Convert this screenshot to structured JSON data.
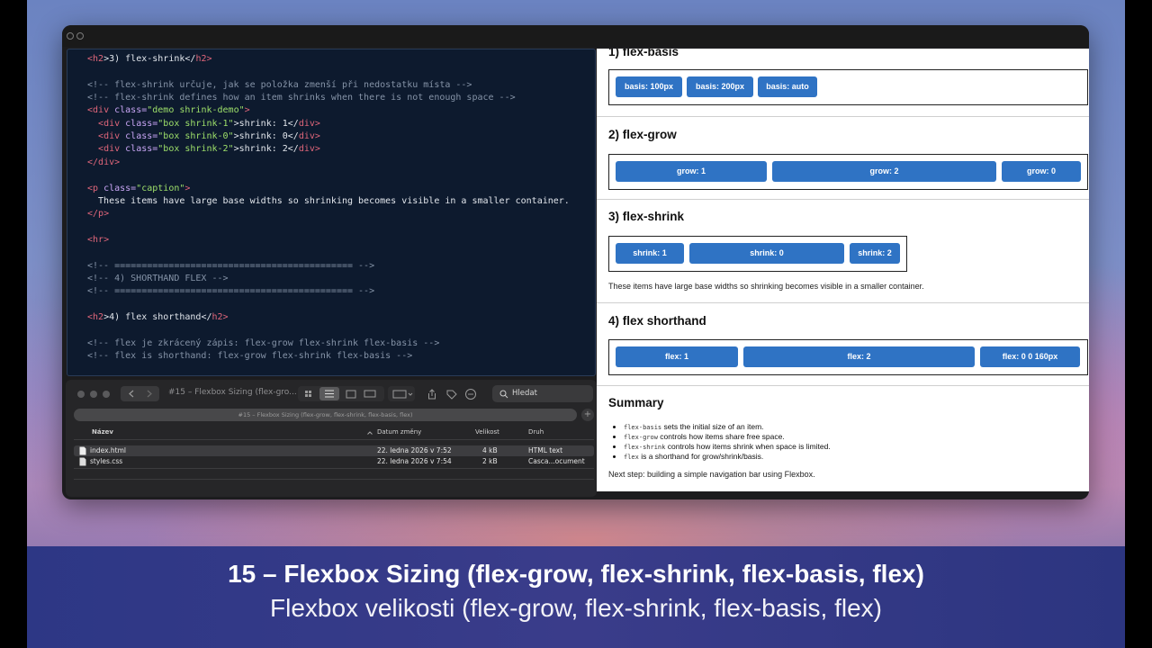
{
  "editor": {
    "lines": [
      [
        [
          "<",
          "tag"
        ],
        [
          "h2",
          "tag"
        ],
        [
          ">3) flex-shrink</",
          "txt"
        ],
        [
          "h2",
          "tag"
        ],
        [
          ">",
          "tag"
        ]
      ],
      [],
      [
        [
          "<!-- flex-shrink určuje, jak se položka zmenší při nedostatku místa -->",
          "cmt"
        ]
      ],
      [
        [
          "<!-- flex-shrink defines how an item shrinks when there is not enough space -->",
          "cmt"
        ]
      ],
      [
        [
          "<",
          "tag"
        ],
        [
          "div ",
          "tag"
        ],
        [
          "class=",
          "attr"
        ],
        [
          "\"demo shrink-demo\"",
          "str"
        ],
        [
          ">",
          "tag"
        ]
      ],
      [
        [
          "  <",
          "tag"
        ],
        [
          "div ",
          "tag"
        ],
        [
          "class=",
          "attr"
        ],
        [
          "\"box shrink-1\"",
          "str"
        ],
        [
          ">shrink: 1</",
          "txt"
        ],
        [
          "div",
          "tag"
        ],
        [
          ">",
          "tag"
        ]
      ],
      [
        [
          "  <",
          "tag"
        ],
        [
          "div ",
          "tag"
        ],
        [
          "class=",
          "attr"
        ],
        [
          "\"box shrink-0\"",
          "str"
        ],
        [
          ">shrink: 0</",
          "txt"
        ],
        [
          "div",
          "tag"
        ],
        [
          ">",
          "tag"
        ]
      ],
      [
        [
          "  <",
          "tag"
        ],
        [
          "div ",
          "tag"
        ],
        [
          "class=",
          "attr"
        ],
        [
          "\"box shrink-2\"",
          "str"
        ],
        [
          ">shrink: 2</",
          "txt"
        ],
        [
          "div",
          "tag"
        ],
        [
          ">",
          "tag"
        ]
      ],
      [
        [
          "</",
          "tag"
        ],
        [
          "div",
          "tag"
        ],
        [
          ">",
          "tag"
        ]
      ],
      [],
      [
        [
          "<",
          "tag"
        ],
        [
          "p ",
          "tag"
        ],
        [
          "class=",
          "attr"
        ],
        [
          "\"caption\"",
          "str"
        ],
        [
          ">",
          "tag"
        ]
      ],
      [
        [
          "  These items have large base widths so shrinking becomes visible in a smaller container.",
          "txt"
        ]
      ],
      [
        [
          "</",
          "tag"
        ],
        [
          "p",
          "tag"
        ],
        [
          ">",
          "tag"
        ]
      ],
      [],
      [
        [
          "<",
          "tag"
        ],
        [
          "hr",
          "tag"
        ],
        [
          ">",
          "tag"
        ]
      ],
      [],
      [
        [
          "<!-- ============================================ -->",
          "cmt"
        ]
      ],
      [
        [
          "<!-- 4) SHORTHAND FLEX -->",
          "cmt"
        ]
      ],
      [
        [
          "<!-- ============================================ -->",
          "cmt"
        ]
      ],
      [],
      [
        [
          "<",
          "tag"
        ],
        [
          "h2",
          "tag"
        ],
        [
          ">4) flex shorthand</",
          "txt"
        ],
        [
          "h2",
          "tag"
        ],
        [
          ">",
          "tag"
        ]
      ],
      [],
      [
        [
          "<!-- flex je zkrácený zápis: flex-grow flex-shrink flex-basis -->",
          "cmt"
        ]
      ],
      [
        [
          "<!-- flex is shorthand: flex-grow flex-shrink flex-basis -->",
          "cmt"
        ]
      ]
    ]
  },
  "finder": {
    "title": "#15 – Flexbox Sizing (flex-gro...",
    "search_placeholder": "Hledat",
    "path": "#15 – Flexbox Sizing (flex-grow, flex-shrink, flex-basis, flex)",
    "columns": {
      "name": "Název",
      "date": "Datum změny",
      "size": "Velikost",
      "kind": "Druh"
    },
    "files": [
      {
        "name": "index.html",
        "date": "22. ledna 2026 v 7:52",
        "size": "4 kB",
        "kind": "HTML text"
      },
      {
        "name": "styles.css",
        "date": "22. ledna 2026 v 7:54",
        "size": "2 kB",
        "kind": "Casca...ocument"
      }
    ]
  },
  "preview": {
    "basis": {
      "heading": "1) flex-basis",
      "boxes": [
        "basis: 100px",
        "basis: 200px",
        "basis: auto"
      ]
    },
    "grow": {
      "heading": "2) flex-grow",
      "boxes": [
        "grow: 1",
        "grow: 2",
        "grow: 0"
      ]
    },
    "shrink": {
      "heading": "3) flex-shrink",
      "boxes": [
        "shrink: 1",
        "shrink: 0",
        "shrink: 2"
      ],
      "caption": "These items have large base widths so shrinking becomes visible in a smaller container."
    },
    "shorthand": {
      "heading": "4) flex shorthand",
      "boxes": [
        "flex: 1",
        "flex: 2",
        "flex: 0 0 160px"
      ]
    },
    "summary": {
      "heading": "Summary",
      "items": [
        {
          "code": "flex-basis",
          "text": " sets the initial size of an item."
        },
        {
          "code": "flex-grow",
          "text": " controls how items share free space."
        },
        {
          "code": "flex-shrink",
          "text": " controls how items shrink when space is limited."
        },
        {
          "code": "flex",
          "text": " is a shorthand for grow/shrink/basis."
        }
      ],
      "next": "Next step: building a simple navigation bar using Flexbox."
    }
  },
  "banner": {
    "title": "15 – Flexbox Sizing (flex-grow, flex-shrink, flex-basis, flex)",
    "subtitle": "Flexbox velikosti (flex-grow, flex-shrink, flex-basis, flex)"
  }
}
